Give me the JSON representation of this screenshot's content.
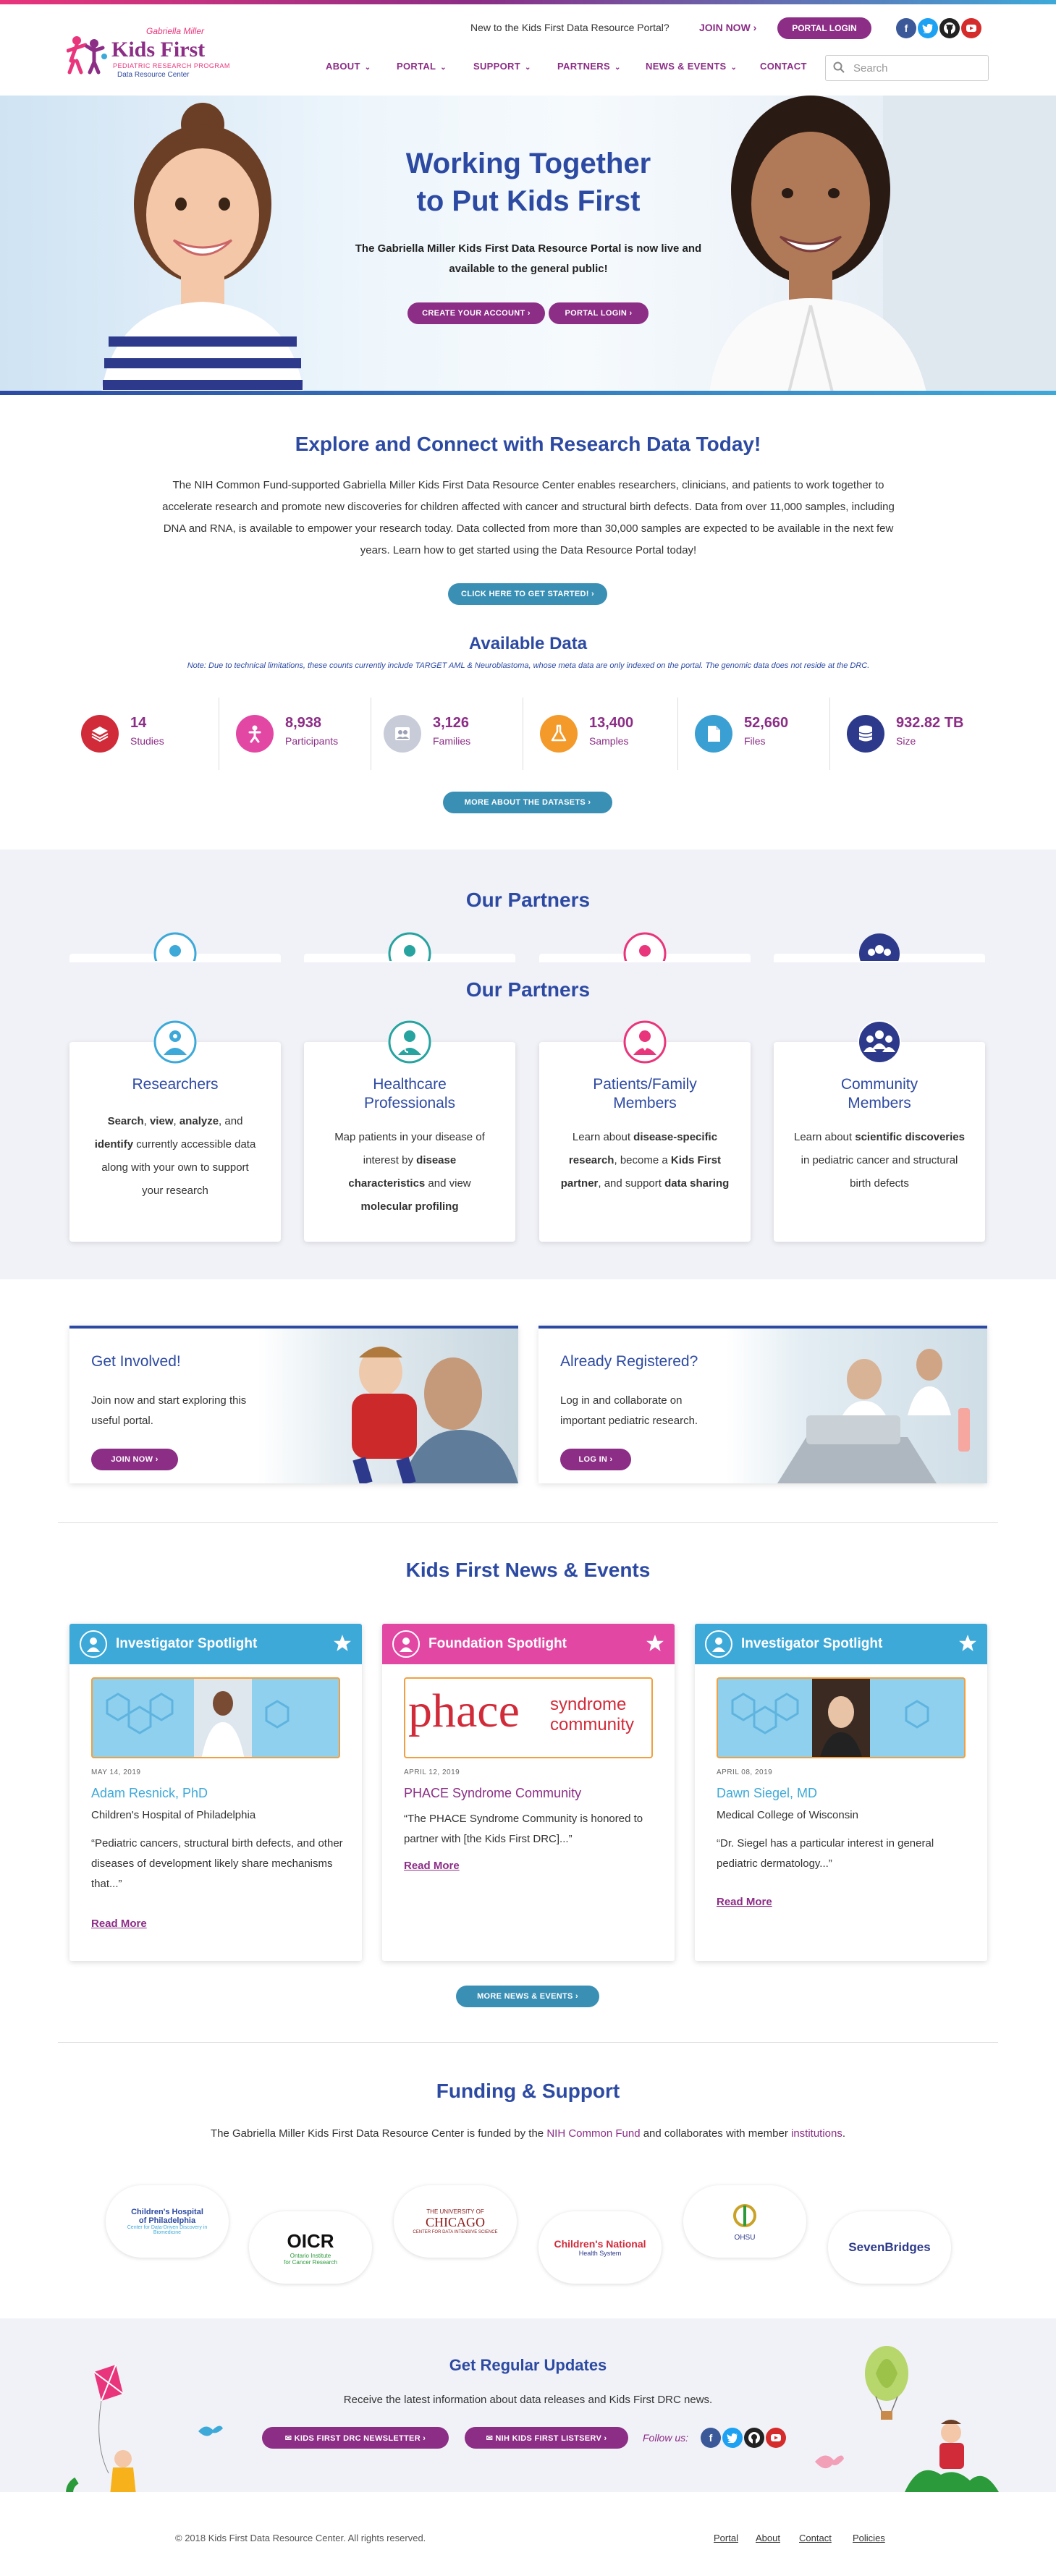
{
  "header": {
    "logo": {
      "name": "Kids First",
      "tagline_top": "Gabriella Miller",
      "tagline_mid": "PEDIATRIC RESEARCH PROGRAM",
      "tagline_bottom": "Data Resource Center"
    },
    "new_to_text": "New to the Kids First Data Resource Portal?",
    "join_now": "JOIN NOW ›",
    "portal_login": "PORTAL LOGIN",
    "social": [
      "facebook-icon",
      "twitter-icon",
      "github-icon",
      "youtube-icon"
    ],
    "nav": [
      {
        "label": "ABOUT"
      },
      {
        "label": "PORTAL"
      },
      {
        "label": "SUPPORT"
      },
      {
        "label": "PARTNERS"
      },
      {
        "label": "NEWS & EVENTS"
      },
      {
        "label": "CONTACT"
      }
    ],
    "search_placeholder": "Search"
  },
  "hero": {
    "title_line1": "Working Together",
    "title_line2": "to Put Kids First",
    "subtitle_line1": "The Gabriella Miller Kids First Data Resource Portal is now live and",
    "subtitle_line2": "available to the general public!",
    "create_account": "CREATE YOUR ACCOUNT ›",
    "portal_login": "PORTAL LOGIN ›"
  },
  "explore": {
    "title": "Explore and Connect with Research Data Today!",
    "paragraph": "The NIH Common Fund-supported Gabriella Miller Kids First Data Resource Center enables researchers, clinicians, and patients to work together to accelerate research and promote new discoveries for children affected with cancer and structural birth defects. Data from over 11,000 samples, including DNA and RNA, is available to empower your research today. Data collected from more than 30,000 samples are expected to be available in the next few years. Learn how to get started using the Data Resource Portal today!",
    "cta": "CLICK HERE TO GET STARTED! ›"
  },
  "available_data": {
    "title": "Available Data",
    "note": "Note: Due to technical limitations, these counts currently include TARGET AML & Neuroblastoma, whose meta data are only indexed on the portal. The genomic data does not reside at the DRC.",
    "stats": [
      {
        "value": "14",
        "label": "Studies",
        "color": "#d12b3a",
        "icon": "layers-icon"
      },
      {
        "value": "8,938",
        "label": "Participants",
        "color": "#e347a4",
        "icon": "person-icon"
      },
      {
        "value": "3,126",
        "label": "Families",
        "color": "#c8ccd9",
        "icon": "family-icon"
      },
      {
        "value": "13,400",
        "label": "Samples",
        "color": "#f39a2b",
        "icon": "flask-icon"
      },
      {
        "value": "52,660",
        "label": "Files",
        "color": "#3a9fd2",
        "icon": "file-icon"
      },
      {
        "value": "932.82 TB",
        "label": "Size",
        "color": "#2d3a8c",
        "icon": "database-icon"
      }
    ],
    "more": "MORE ABOUT THE DATASETS ›"
  },
  "partners": {
    "title": "Our Partners",
    "cards": [
      {
        "title_line1": "Researchers",
        "title_line2": "",
        "color": "#3da9d9",
        "icon": "researcher-icon",
        "desc": [
          [
            "b",
            "Search"
          ],
          [
            "n",
            ", "
          ],
          [
            "b",
            "view"
          ],
          [
            "n",
            ", "
          ],
          [
            "b",
            "analyze"
          ],
          [
            "n",
            ", and "
          ],
          [
            "b",
            "identify"
          ],
          [
            "n",
            " currently accessible data along with your own to support your research"
          ]
        ]
      },
      {
        "title_line1": "Healthcare",
        "title_line2": "Professionals",
        "color": "#27a3a0",
        "icon": "doctor-icon",
        "desc": [
          [
            "n",
            "Map patients in your disease of interest by "
          ],
          [
            "b",
            "disease characteristics"
          ],
          [
            "n",
            " and view "
          ],
          [
            "b",
            "molecular profiling"
          ]
        ]
      },
      {
        "title_line1": "Patients/Family",
        "title_line2": "Members",
        "color": "#e9357b",
        "icon": "patient-icon",
        "desc": [
          [
            "n",
            "Learn about "
          ],
          [
            "b",
            "disease-specific research"
          ],
          [
            "n",
            ", become a "
          ],
          [
            "b",
            "Kids First partner"
          ],
          [
            "n",
            ", and support "
          ],
          [
            "b",
            "data sharing"
          ]
        ]
      },
      {
        "title_line1": "Community",
        "title_line2": "Members",
        "color": "#2d3a8c",
        "icon": "community-icon",
        "desc": [
          [
            "n",
            "Learn about "
          ],
          [
            "b",
            "scientific discoveries"
          ],
          [
            "n",
            " in pediatric cancer and structural birth defects"
          ]
        ]
      }
    ]
  },
  "get_involved": {
    "title": "Get Involved!",
    "desc": "Join now and start exploring this useful portal.",
    "button": "JOIN NOW ›"
  },
  "already_registered": {
    "title": "Already Registered?",
    "desc": "Log in and collaborate on important pediatric research.",
    "button": "LOG IN ›"
  },
  "news": {
    "title": "Kids First News & Events",
    "cards": [
      {
        "type": "Investigator Spotlight",
        "color": "#3da9d9",
        "date": "MAY 14, 2019",
        "name": "Adam Resnick, PhD",
        "org": "Children's Hospital of Philadelphia",
        "quote": "“Pediatric cancers, structural birth defects, and other diseases of development likely share mechanisms that...”",
        "read_more": "Read More"
      },
      {
        "type": "Foundation Spotlight",
        "color": "#e347a4",
        "date": "APRIL 12, 2019",
        "name": "PHACE Syndrome Community",
        "org": "",
        "quote": "“The PHACE Syndrome Community is honored to partner with [the Kids First DRC]...”",
        "read_more": "Read More",
        "logo_main": "phace",
        "logo_side1": "syndrome",
        "logo_side2": "community"
      },
      {
        "type": "Investigator Spotlight",
        "color": "#3da9d9",
        "date": "APRIL 08, 2019",
        "name": "Dawn Siegel, MD",
        "org": "Medical College of Wisconsin",
        "quote": "“Dr. Siegel has a particular interest in general pediatric dermatology...”",
        "read_more": "Read More"
      }
    ],
    "more": "MORE NEWS & EVENTS ›"
  },
  "funding": {
    "title": "Funding & Support",
    "text_before": "The Gabriella Miller Kids First Data Resource Center is funded by the ",
    "link1": "NIH Common Fund",
    "text_mid": " and collaborates with member ",
    "link2": "institutions",
    "text_after": ".",
    "logos": [
      {
        "line1": "Children's Hospital",
        "line2": "of Philadelphia",
        "line3": "Center for Data-Driven Discovery in Biomedicine"
      },
      {
        "line1": "OICR",
        "line2": "Ontario Institute",
        "line3": "for Cancer Research"
      },
      {
        "line1": "THE UNIVERSITY OF",
        "line2": "CHICAGO",
        "line3": "CENTER FOR DATA INTENSIVE SCIENCE"
      },
      {
        "line1": "Children's National",
        "line2": "Health System",
        "line3": ""
      },
      {
        "line1": "OHSU",
        "line2": "",
        "line3": ""
      },
      {
        "line1": "SevenBridges",
        "line2": "",
        "line3": ""
      }
    ]
  },
  "updates": {
    "title": "Get Regular Updates",
    "desc": "Receive the latest information about data releases and Kids First DRC news.",
    "newsletter": "✉ KIDS FIRST DRC NEWSLETTER ›",
    "listserv": "✉ NIH KIDS FIRST LISTSERV ›",
    "follow": "Follow us:"
  },
  "footer": {
    "copyright": "© 2018 Kids First Data Resource Center. All rights reserved.",
    "links": [
      "Portal",
      "About",
      "Contact",
      "Policies"
    ]
  }
}
